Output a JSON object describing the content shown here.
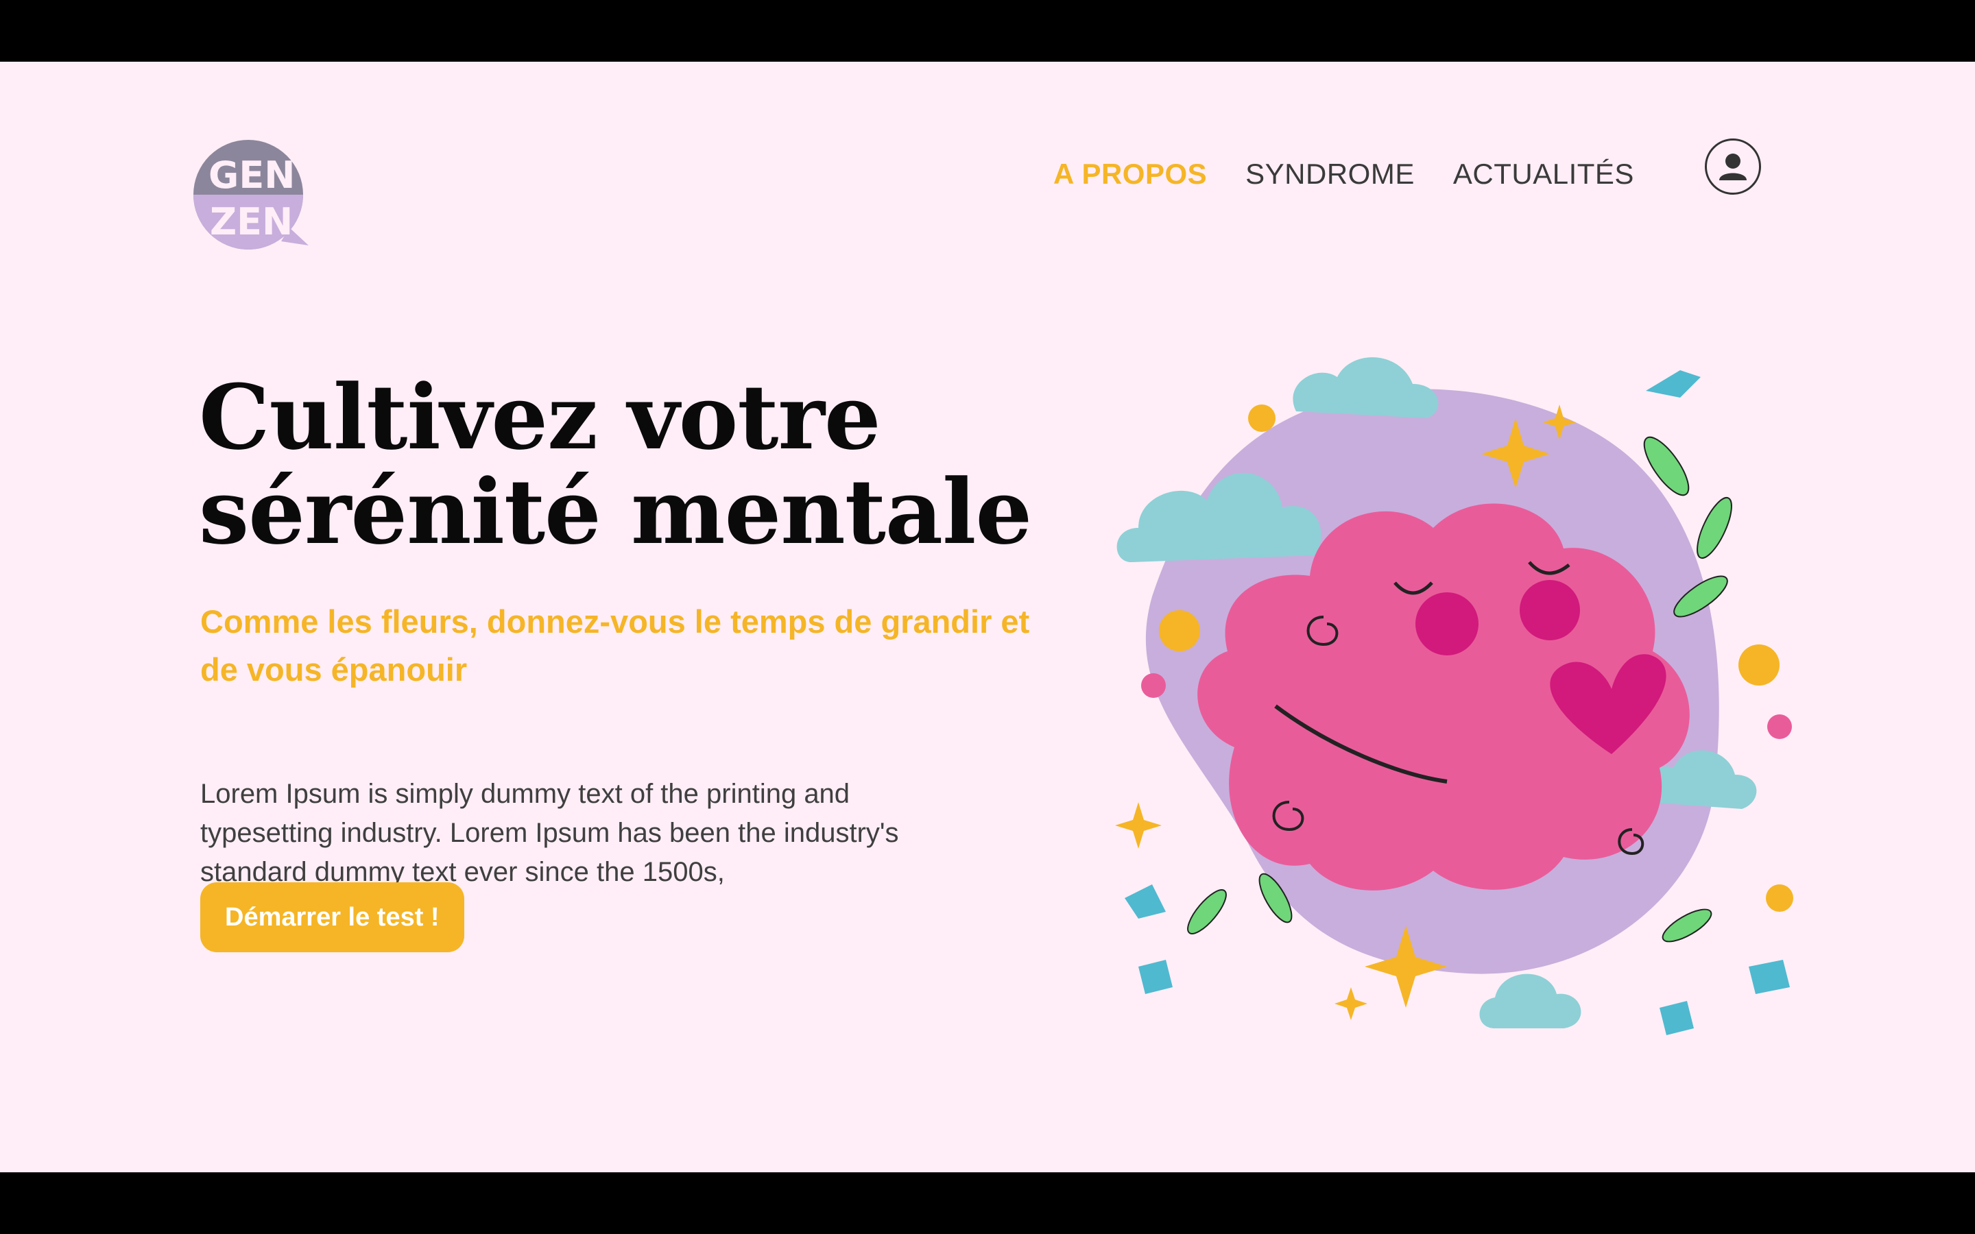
{
  "logo": {
    "text": "GENZEN",
    "icon": "speech-bubble-logo"
  },
  "nav": {
    "items": [
      {
        "label": "A PROPOS",
        "active": true
      },
      {
        "label": "SYNDROME",
        "active": false
      },
      {
        "label": "ACTUALITÉS",
        "active": false
      }
    ],
    "user_icon": "user-account-icon"
  },
  "hero": {
    "title_line1": "Cultivez votre",
    "title_line2": "sérénité mentale",
    "subtitle": "Comme les fleurs, donnez-vous le temps de  grandir et de vous épanouir",
    "body": "Lorem Ipsum is simply dummy text of the printing and typesetting industry. Lorem Ipsum has been the industry's standard dummy text ever since the 1500s,",
    "cta_label": "Démarrer le test !"
  },
  "colors": {
    "background": "#ffeef7",
    "accent": "#f5b526",
    "brain": "#e95c9a",
    "lavender": "#c8aedc",
    "cloud": "#8ed0d6",
    "leaf": "#6fd67a"
  }
}
